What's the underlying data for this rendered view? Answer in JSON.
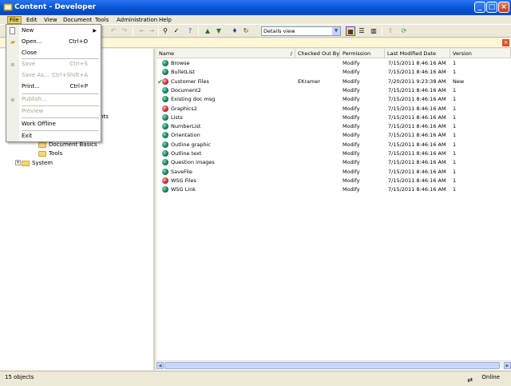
{
  "window": {
    "title": "Content - Developer"
  },
  "window_controls": {
    "minimize": "_",
    "maximize": "□",
    "close": "×"
  },
  "menubar": [
    {
      "label": "File",
      "active": true
    },
    {
      "label": "Edit"
    },
    {
      "label": "View"
    },
    {
      "label": "Document"
    },
    {
      "label": "Tools"
    },
    {
      "label": "Administration"
    },
    {
      "label": "Help"
    }
  ],
  "toolbar": {
    "view_select": "Details view"
  },
  "file_menu": {
    "items": [
      {
        "label": "New",
        "shortcut": "",
        "submenu": true,
        "enabled": true
      },
      {
        "label": "Open...",
        "shortcut": "Ctrl+O",
        "enabled": true
      },
      {
        "label": "Close",
        "shortcut": "",
        "enabled": true
      },
      {
        "label": "Save",
        "shortcut": "Ctrl+S",
        "enabled": false
      },
      {
        "label": "Save As...",
        "shortcut": "Ctrl+Shift+A",
        "enabled": false
      },
      {
        "label": "Print...",
        "shortcut": "Ctrl+P",
        "enabled": true
      },
      {
        "label": "Publish...",
        "shortcut": "",
        "enabled": false
      },
      {
        "label": "Preview",
        "shortcut": "",
        "enabled": false
      },
      {
        "label": "Work Offline",
        "shortcut": "",
        "enabled": true
      },
      {
        "label": "Exit",
        "shortcut": "",
        "enabled": true
      }
    ]
  },
  "tree": {
    "visible_partial": "nts",
    "nodes": [
      {
        "label": "Document Basics"
      },
      {
        "label": "Tools"
      },
      {
        "label": "System"
      }
    ]
  },
  "list": {
    "columns": [
      "Name",
      "Checked Out By",
      "Permission",
      "Last Modified Date",
      "Version"
    ],
    "rows": [
      {
        "name": "Browse",
        "checked_out_by": "",
        "permission": "Modify",
        "modified": "7/15/2011 8:46:16 AM",
        "version": "1",
        "icon": "globe"
      },
      {
        "name": "BulletList",
        "checked_out_by": "",
        "permission": "Modify",
        "modified": "7/15/2011 8:46:16 AM",
        "version": "1",
        "icon": "globe"
      },
      {
        "name": "Customer Files",
        "checked_out_by": "EKramer",
        "permission": "Modify",
        "modified": "7/20/2011 9:23:38 AM",
        "version": "New",
        "icon": "graphic",
        "checked": true
      },
      {
        "name": "Document2",
        "checked_out_by": "",
        "permission": "Modify",
        "modified": "7/15/2011 8:46:16 AM",
        "version": "1",
        "icon": "globe"
      },
      {
        "name": "Existing doc msg",
        "checked_out_by": "",
        "permission": "Modify",
        "modified": "7/15/2011 8:46:16 AM",
        "version": "1",
        "icon": "globe"
      },
      {
        "name": "Graphics2",
        "checked_out_by": "",
        "permission": "Modify",
        "modified": "7/15/2011 8:46:16 AM",
        "version": "1",
        "icon": "graphic"
      },
      {
        "name": "Lists",
        "checked_out_by": "",
        "permission": "Modify",
        "modified": "7/15/2011 8:46:16 AM",
        "version": "1",
        "icon": "globe"
      },
      {
        "name": "NumberList",
        "checked_out_by": "",
        "permission": "Modify",
        "modified": "7/15/2011 8:46:16 AM",
        "version": "1",
        "icon": "globe"
      },
      {
        "name": "Orientation",
        "checked_out_by": "",
        "permission": "Modify",
        "modified": "7/15/2011 8:46:16 AM",
        "version": "1",
        "icon": "globe"
      },
      {
        "name": "Outline graphic",
        "checked_out_by": "",
        "permission": "Modify",
        "modified": "7/15/2011 8:46:16 AM",
        "version": "1",
        "icon": "globe"
      },
      {
        "name": "Outline text",
        "checked_out_by": "",
        "permission": "Modify",
        "modified": "7/15/2011 8:46:16 AM",
        "version": "1",
        "icon": "globe"
      },
      {
        "name": "Question images",
        "checked_out_by": "",
        "permission": "Modify",
        "modified": "7/15/2011 8:46:16 AM",
        "version": "1",
        "icon": "globe"
      },
      {
        "name": "SaveFile",
        "checked_out_by": "",
        "permission": "Modify",
        "modified": "7/15/2011 8:46:16 AM",
        "version": "1",
        "icon": "globe"
      },
      {
        "name": "WSG Files",
        "checked_out_by": "",
        "permission": "Modify",
        "modified": "7/15/2011 8:46:16 AM",
        "version": "1",
        "icon": "graphic"
      },
      {
        "name": "WSG Link",
        "checked_out_by": "",
        "permission": "Modify",
        "modified": "7/15/2011 8:46:16 AM",
        "version": "1",
        "icon": "globe"
      }
    ]
  },
  "status": {
    "count": "15 objects",
    "mode": "Online"
  }
}
